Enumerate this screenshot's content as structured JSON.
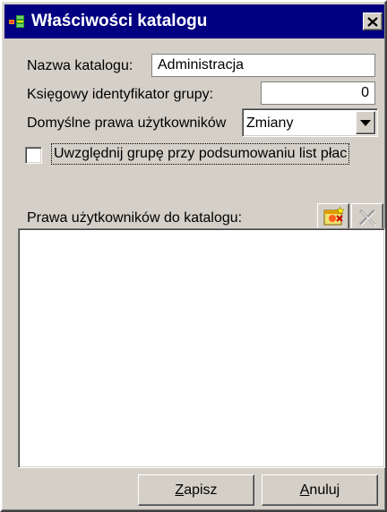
{
  "window": {
    "title": "Właściwości katalogu"
  },
  "icons": {
    "app": "catalog-app-icon",
    "close": "close-icon",
    "add": "add-user-icon",
    "delete": "delete-icon",
    "dropdown": "chevron-down-icon"
  },
  "colors": {
    "titlebar": "#000080",
    "face": "#d4d0c8",
    "field": "#ffffff"
  },
  "form": {
    "name_label": "Nazwa katalogu:",
    "name_value": "Administracja",
    "group_id_label": "Księgowy identyfikator grupy:",
    "group_id_value": "0",
    "default_rights_label": "Domyślne prawa użytkowników",
    "default_rights_value": "Zmiany",
    "include_group_label": "Uwzględnij grupę przy podsumowaniu list płac",
    "include_group_checked": false
  },
  "rights": {
    "label": "Prawa użytkowników do katalogu:",
    "items": []
  },
  "buttons": {
    "save_mnemonic": "Z",
    "save_rest": "apisz",
    "cancel_mnemonic": "A",
    "cancel_rest": "nuluj"
  }
}
